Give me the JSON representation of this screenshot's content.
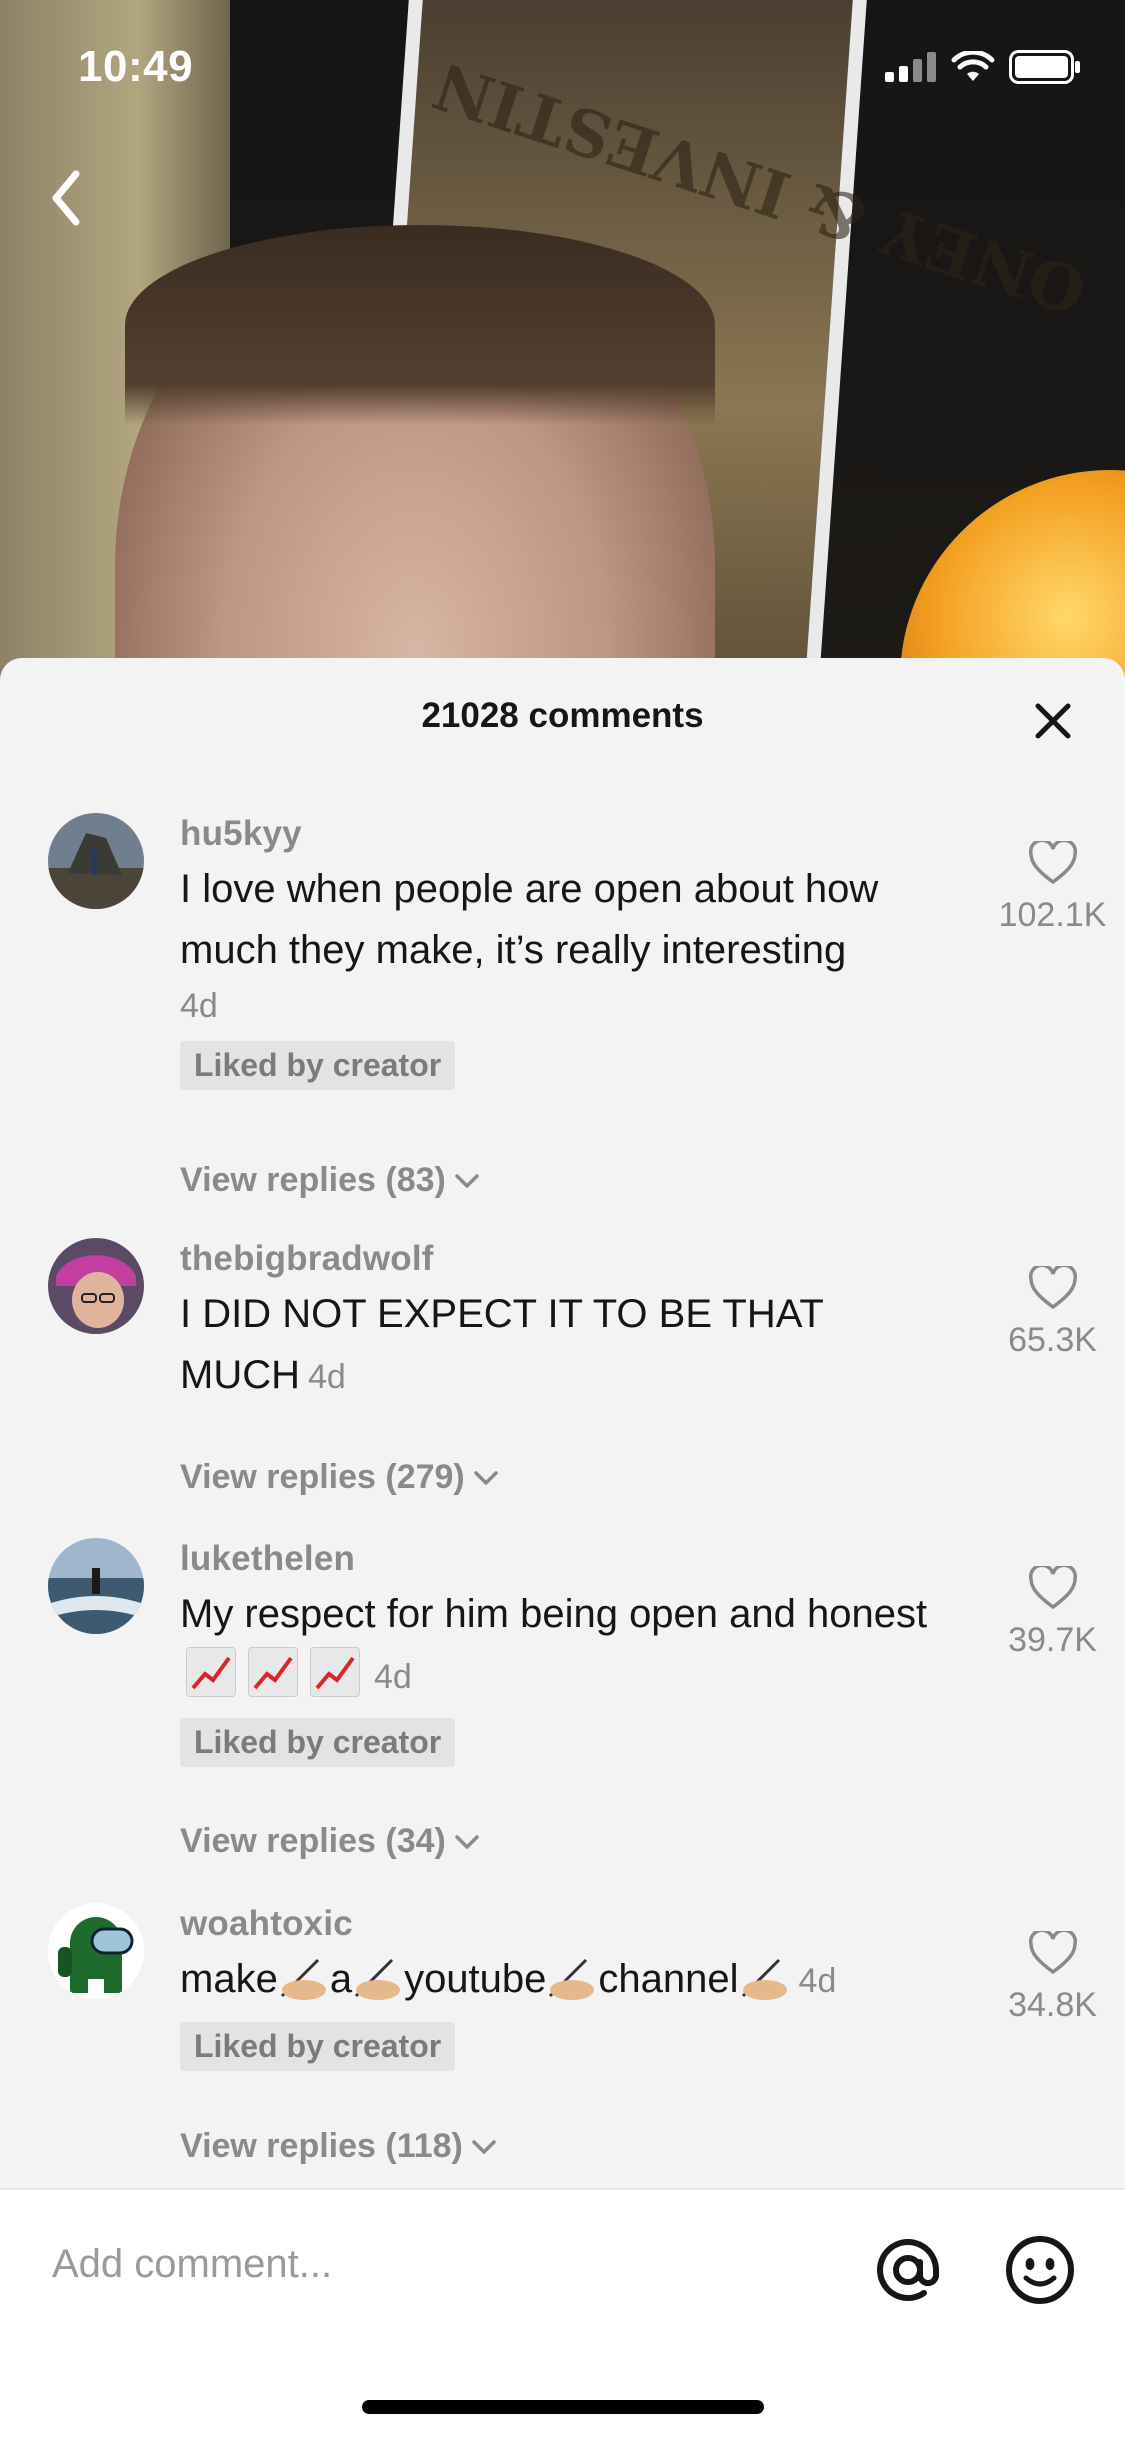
{
  "status_bar": {
    "time": "10:49"
  },
  "video": {
    "frame_text": "ONEY & INVESTIN"
  },
  "sheet": {
    "title": "21028 comments"
  },
  "comments": [
    {
      "username": "hu5kyy",
      "text": "I love when people are open about how much they make, it’s really interesting",
      "age": "4d",
      "liked_by_creator": "Liked by creator",
      "view_replies": "View replies (83)",
      "likes": "102.1K"
    },
    {
      "username": "thebigbradwolf",
      "text": "I DID NOT EXPECT IT TO BE THAT MUCH",
      "age": "4d",
      "view_replies": "View replies (279)",
      "likes": "65.3K"
    },
    {
      "username": "lukethelen",
      "text_prefix": "My respect for him being open and honest",
      "age": "4d",
      "liked_by_creator": "Liked by creator",
      "view_replies": "View replies (34)",
      "likes": "39.7K"
    },
    {
      "username": "woahtoxic",
      "words": [
        "make",
        "a",
        "youtube",
        "channel"
      ],
      "age": "4d",
      "liked_by_creator": "Liked by creator",
      "view_replies": "View replies (118)",
      "likes": "34.8K"
    }
  ],
  "input": {
    "placeholder": "Add comment..."
  },
  "colors": {
    "sheet_bg": "#f3f3f3",
    "text_primary": "#161616",
    "text_secondary": "#8a8a8a"
  }
}
